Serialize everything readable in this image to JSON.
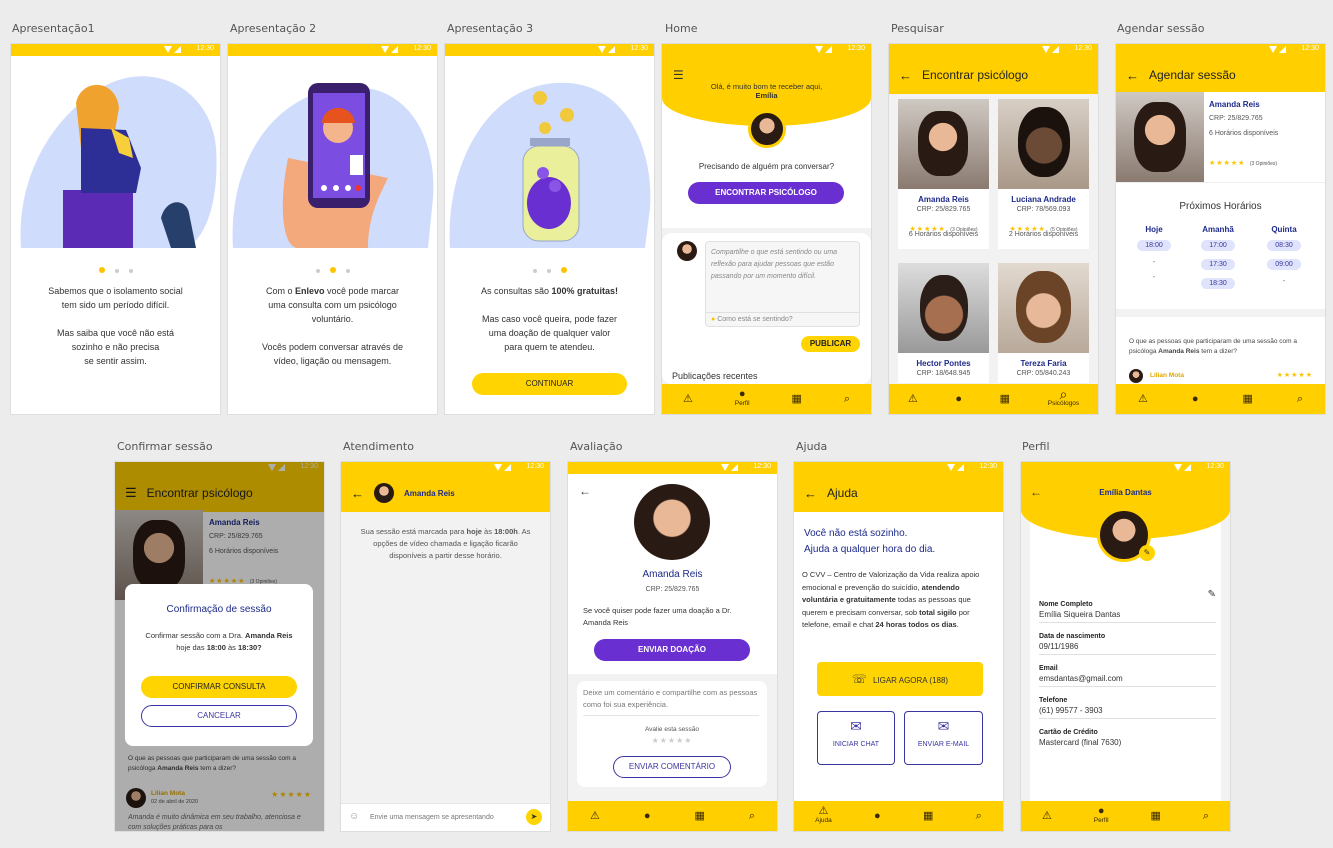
{
  "labels": [
    "Apresentação1",
    "Apresentação 2",
    "Apresentação 3",
    "Home",
    "Pesquisar",
    "Agendar sessão",
    "Confirmar sessão",
    "Atendimento",
    "Avaliação",
    "Ajuda",
    "Perfil"
  ],
  "status_time": "12:30",
  "p1": {
    "l1": "Sabemos que o isolamento social",
    "l2": "tem sido um período difícil.",
    "l3": "Mas saiba que você não está",
    "l4": "sozinho e não precisa",
    "l5": "se sentir assim."
  },
  "p2": {
    "l1a": "Com o ",
    "l1b": "Enlevo",
    "l1c": " você pode marcar",
    "l2": "uma consulta com um psicólogo",
    "l3": "voluntário.",
    "l4": "Vocês podem conversar através de",
    "l5": "vídeo, ligação ou mensagem."
  },
  "p3": {
    "l1a": "As consultas são ",
    "l1b": "100% gratuitas!",
    "l2": "Mas caso você queira, pode fazer",
    "l3": "uma doação de qualquer valor",
    "l4": "para quem te atendeu.",
    "btn": "CONTINUAR"
  },
  "home": {
    "greet": "Olá, é muito bom te receber aqui,",
    "name": "Emília",
    "q": "Precisando de alguém pra conversar?",
    "btn": "ENCONTRAR PSICÓLOGO",
    "post": "Compartilhe o que está sentindo ou uma  reflexão para ajudar pessoas que estão passando por um momento difícil.",
    "feel": "Como está se sentindo?",
    "publish": "PUBLICAR",
    "recent": "Publicações recentes",
    "nav_profile": "Perfil"
  },
  "search": {
    "title": "Encontrar psicólogo",
    "nav": "Psicólogos",
    "cards": [
      {
        "name": "Amanda Reis",
        "crp": "CRP: 25/829.765",
        "op": "(3 Opiniões)",
        "hours": "6 Horários disponíveis"
      },
      {
        "name": "Luciana Andrade",
        "crp": "CRP: 78/569.093",
        "op": "(5 Opiniões)",
        "hours": "2 Horários disponíveis"
      },
      {
        "name": "Hector Pontes",
        "crp": "CRP: 18/648.945"
      },
      {
        "name": "Tereza Faria",
        "crp": "CRP: 05/840.243"
      }
    ]
  },
  "schedule": {
    "title": "Agendar sessão",
    "name": "Amanda Reis",
    "crp": "CRP: 25/829.765",
    "hours": "6 Horários disponíveis",
    "op": "(3 Opiniões)",
    "next": "Próximos Horários",
    "days": [
      "Hoje",
      "Amanhã",
      "Quinta"
    ],
    "d1": [
      "18:00",
      "-",
      "-"
    ],
    "d2": [
      "17:00",
      "17:30",
      "18:30"
    ],
    "d3": [
      "08:30",
      "09:00",
      "-"
    ],
    "rev_a": "O que as pessoas que participaram de uma sessão com a psicóloga ",
    "rev_b": "Amanda Reis",
    "rev_c": " tem a dizer?",
    "reviewer": "Lilian Mota"
  },
  "confirm": {
    "title": "Encontrar psicólogo",
    "name": "Amanda Reis",
    "crp": "CRP: 25/829.765",
    "hours": "6 Horários disponíveis",
    "op": "(3 Opiniões)",
    "dlg_title": "Confirmação de sessão",
    "m1a": "Confirmar sessão com a Dra. ",
    "m1b": "Amanda Reis",
    "m2a": "hoje das ",
    "m2b": "18:00",
    "m2c": " às ",
    "m2d": "18:30?",
    "ok": "CONFIRMAR CONSULTA",
    "cancel": "CANCELAR",
    "rev_a": "O que as pessoas que participaram de uma sessão com a psicóloga ",
    "rev_b": "Amanda Reis",
    "rev_c": " tem a dizer?",
    "reviewer": "Lilian Mota",
    "date": "02 de abril de 2020",
    "quote": "Amanda é muito dinâmica em seu trabalho, atenciosa e com soluções práticas para os"
  },
  "chat": {
    "name": "Amanda Reis",
    "m_a": "Sua sessão está marcada para ",
    "m_b": "hoje",
    "m_c": " às ",
    "m_d": "18:00h",
    "m_e": ". As opções de vídeo chamada e ligação ficarão disponíveis a partir desse horário.",
    "input": "Envie uma mensagem se apresentando"
  },
  "rate": {
    "name": "Amanda Reis",
    "crp": "CRP: 25/829.765",
    "don": "Se você quiser pode fazer uma doação a Dr. Amanda Reis",
    "btn": "ENVIAR DOAÇÃO",
    "comment": "Deixe um comentário e compartilhe com as pessoas como foi sua experiência.",
    "eval": "Avalie esta sessão",
    "send": "ENVIAR COMENTÁRIO"
  },
  "help": {
    "title": "Ajuda",
    "h1": "Você não está sozinho.",
    "h2": "Ajuda a qualquer hora do dia.",
    "p_a": "O CVV – Centro de Valorização da Vida realiza apoio emocional e prevenção do suicídio, ",
    "p_b": "atendendo voluntária e gratuitamente",
    "p_c": " todas as pessoas que querem e precisam conversar, sob ",
    "p_d": "total sigilo",
    "p_e": " por telefone, email e chat ",
    "p_f": "24 horas todos os dias",
    "p_g": ".",
    "call": "LIGAR AGORA (188)",
    "chatbtn": "INICIAR CHAT",
    "mail": "ENVIAR E-MAIL",
    "nav": "Ajuda"
  },
  "profile": {
    "name": "Emília Dantas",
    "f1": "Nome Completo",
    "v1": "Emília Siqueira Dantas",
    "f2": "Data de nascimento",
    "v2": "09/11/1986",
    "f3": "Email",
    "v3": "emsdantas@gmail.com",
    "f4": "Telefone",
    "v4": "(61) 99577 - 3903",
    "f5": "Cartão de Crédito",
    "v5": "Mastercard (final 7630)",
    "nav": "Perfil"
  }
}
